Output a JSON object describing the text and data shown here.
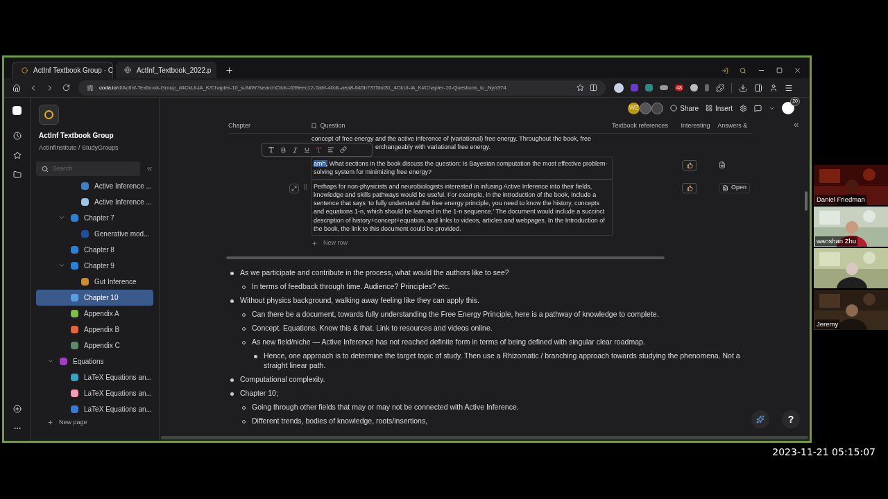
{
  "browser": {
    "tabs": [
      {
        "title": "ActInf Textbook Group · C",
        "selected": true
      },
      {
        "title": "ActInf_Textbook_2022.p",
        "selected": false
      }
    ],
    "url_host": "coda.io",
    "url_path": "/d/ActInf-Textbook-Group_d4CkUI-iA_K/Chapter-10_suNiW?searchClick=639eec12-5abf-40db-aea8-645b7375bd31_4CkUI-iA_K#Chapter-10-Questions_tu_Ny/r374",
    "extension_badge": "48"
  },
  "doc": {
    "title": "ActInf Textbook Group",
    "subtitle": "ActInfInstitute / StudyGroups",
    "search_placeholder": "Search",
    "sidebar": {
      "deep_items": [
        {
          "label": "Active Inference ...",
          "color": "#3b82c4",
          "selected": false
        },
        {
          "label": "Active Inference ...",
          "color": "#9cc3e8",
          "selected": false
        }
      ],
      "mid_items": [
        {
          "label": "Chapter 7",
          "color": "#2f7fd0",
          "selected": false,
          "expanded": true,
          "children": [
            {
              "label": "Generative mod...",
              "color": "#1e4fa0",
              "selected": false
            }
          ]
        },
        {
          "label": "Chapter 8",
          "color": "#2f7fd0",
          "selected": false
        },
        {
          "label": "Chapter 9",
          "color": "#2f7fd0",
          "selected": false,
          "expanded": true,
          "children": [
            {
              "label": "Gut Inference",
              "color": "#d08a30",
              "selected": false
            }
          ]
        },
        {
          "label": "Chapter 10",
          "color": "#5aa0e0",
          "selected": true
        },
        {
          "label": "Appendix A",
          "color": "#7cc04a",
          "selected": false
        },
        {
          "label": "Appendix B",
          "color": "#e0683a",
          "selected": false
        },
        {
          "label": "Appendix C",
          "color": "#5f8a6a",
          "selected": false
        }
      ],
      "items": [
        {
          "label": "Equations",
          "color": "#a040c0",
          "selected": false,
          "expanded": true,
          "children": [
            {
              "label": "LaTeX Equations an...",
              "color": "#3aa0c0",
              "selected": false
            },
            {
              "label": "LaTeX Equations an...",
              "color": "#f0a0b0",
              "selected": false
            },
            {
              "label": "LaTeX Equations an...",
              "color": "#3a7ad0",
              "selected": false
            }
          ]
        }
      ],
      "new_page": "New page"
    },
    "toolbar": {
      "avatar_initials": "WZ",
      "share": "Share",
      "insert": "Insert",
      "notification_badge": "20"
    },
    "table": {
      "columns": [
        "Chapter",
        "Question",
        "Textbook references",
        "Interesting",
        "Answers &"
      ],
      "partial_row": {
        "line_1": "concept of free energy and the active inference of (variational) free energy. Throughout the book, free",
        "line_2": "erchangeably with variational free energy."
      },
      "rows": [
        {
          "selected_text": "amh,",
          "question": "What sections in the book discuss the question: Is Bayesian computation the most effective problem-solving system for minimizing free energy?",
          "answer": null
        },
        {
          "selected_text": null,
          "question": "Perhaps for non-physicists and neurobiologists interested in infusing Active Inference into their fields, knowledge and skills pathways would be useful. For example, in the introduction of the book, include a sentence that says ‘to fully understand the free energy principle, you need to know the history, concepts and equations 1-n, which should be learned in the 1-n sequence.’ The document would include a succinct description of history+concept+equation, and links to videos, articles and webpages. In the Introduction of the book, the link to this document could be provided.",
          "answer": "Open"
        }
      ],
      "new_row": "New row"
    },
    "notes": [
      {
        "text": "As we participate and contribute in the process, what would the authors like to see?",
        "children": [
          {
            "text": "In terms of feedback through time. Audience? Principles? etc."
          }
        ]
      },
      {
        "text": "Without physics background, walking away feeling like they can apply this.",
        "children": [
          {
            "text": "Can there be a document, towards fully understanding the Free Energy Principle, here is a pathway of knowledge to complete."
          },
          {
            "text": "Concept. Equations. Know this & that. Link to resources and videos online."
          },
          {
            "text": "As new field/niche — Active Inference has not reached definite form in terms of being defined with singular clear roadmap.",
            "children": [
              {
                "text": "Hence, one approach is to determine the target topic of study. Then use a Rhizomatic / branching approach towards studying the phenomena. Not a straight linear path."
              }
            ]
          }
        ]
      },
      {
        "text": "Computational complexity."
      },
      {
        "text": "Chapter 10;",
        "children": [
          {
            "text": "Going through other fields that may or may not be connected with Active Inference."
          },
          {
            "text": "Different trends, bodies of knowledge, roots/insertions,"
          }
        ]
      }
    ],
    "help": "?"
  },
  "participants": [
    {
      "kind": "picture",
      "name": "Daniel Friedman"
    },
    {
      "kind": "picture",
      "name": "wanshan Zhu"
    },
    {
      "kind": "picture"
    },
    {
      "kind": "picture",
      "name": "Jeremy"
    }
  ],
  "timestamp": "2023-11-21 05:15:07"
}
